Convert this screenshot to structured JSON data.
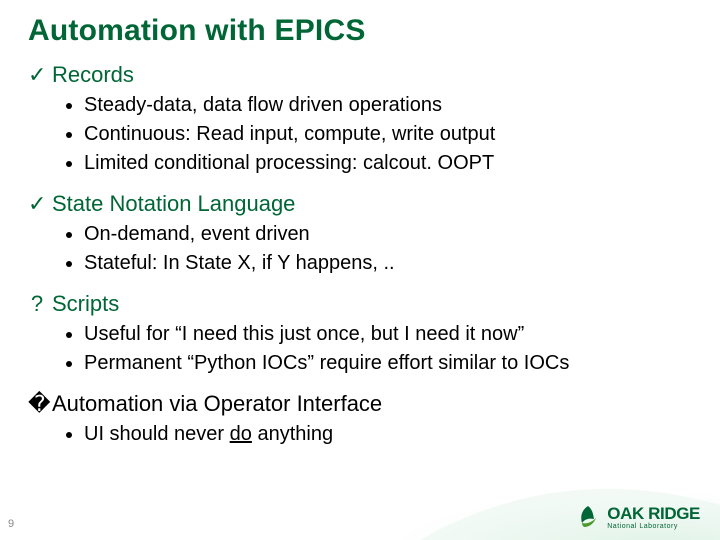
{
  "title": "Automation with EPICS",
  "sections": {
    "s0": {
      "mark": "✓",
      "label": "Records",
      "bullets": [
        "Steady-data, data flow driven operations",
        "Continuous: Read input, compute, write output",
        "Limited conditional processing: calcout. OOPT"
      ]
    },
    "s1": {
      "mark": "✓",
      "label": "State Notation Language",
      "bullets": [
        "On-demand, event driven",
        "Stateful: In State X, if Y happens, .."
      ]
    },
    "s2": {
      "mark": "?",
      "label": "Scripts",
      "bullets": [
        "Useful for “I need this just once, but I need it now”",
        "Permanent “Python IOCs” require effort similar to IOCs"
      ]
    },
    "s3": {
      "mark": "�",
      "label": "Automation via Operator Interface",
      "bullet_pre": "UI should never ",
      "bullet_ul": "do",
      "bullet_post": " anything"
    }
  },
  "slide_number": "9",
  "logo": {
    "main": "OAK RIDGE",
    "sub": "National Laboratory"
  }
}
